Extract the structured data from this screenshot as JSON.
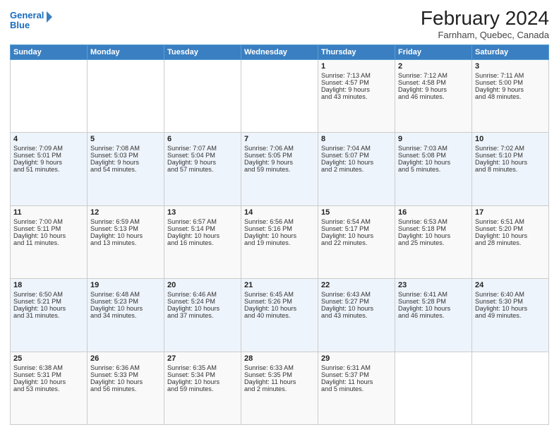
{
  "logo": {
    "line1": "General",
    "line2": "Blue",
    "icon": "▶"
  },
  "title": "February 2024",
  "subtitle": "Farnham, Quebec, Canada",
  "weekdays": [
    "Sunday",
    "Monday",
    "Tuesday",
    "Wednesday",
    "Thursday",
    "Friday",
    "Saturday"
  ],
  "weeks": [
    [
      {
        "day": "",
        "content": ""
      },
      {
        "day": "",
        "content": ""
      },
      {
        "day": "",
        "content": ""
      },
      {
        "day": "",
        "content": ""
      },
      {
        "day": "1",
        "content": "Sunrise: 7:13 AM\nSunset: 4:57 PM\nDaylight: 9 hours\nand 43 minutes."
      },
      {
        "day": "2",
        "content": "Sunrise: 7:12 AM\nSunset: 4:58 PM\nDaylight: 9 hours\nand 46 minutes."
      },
      {
        "day": "3",
        "content": "Sunrise: 7:11 AM\nSunset: 5:00 PM\nDaylight: 9 hours\nand 48 minutes."
      }
    ],
    [
      {
        "day": "4",
        "content": "Sunrise: 7:09 AM\nSunset: 5:01 PM\nDaylight: 9 hours\nand 51 minutes."
      },
      {
        "day": "5",
        "content": "Sunrise: 7:08 AM\nSunset: 5:03 PM\nDaylight: 9 hours\nand 54 minutes."
      },
      {
        "day": "6",
        "content": "Sunrise: 7:07 AM\nSunset: 5:04 PM\nDaylight: 9 hours\nand 57 minutes."
      },
      {
        "day": "7",
        "content": "Sunrise: 7:06 AM\nSunset: 5:05 PM\nDaylight: 9 hours\nand 59 minutes."
      },
      {
        "day": "8",
        "content": "Sunrise: 7:04 AM\nSunset: 5:07 PM\nDaylight: 10 hours\nand 2 minutes."
      },
      {
        "day": "9",
        "content": "Sunrise: 7:03 AM\nSunset: 5:08 PM\nDaylight: 10 hours\nand 5 minutes."
      },
      {
        "day": "10",
        "content": "Sunrise: 7:02 AM\nSunset: 5:10 PM\nDaylight: 10 hours\nand 8 minutes."
      }
    ],
    [
      {
        "day": "11",
        "content": "Sunrise: 7:00 AM\nSunset: 5:11 PM\nDaylight: 10 hours\nand 11 minutes."
      },
      {
        "day": "12",
        "content": "Sunrise: 6:59 AM\nSunset: 5:13 PM\nDaylight: 10 hours\nand 13 minutes."
      },
      {
        "day": "13",
        "content": "Sunrise: 6:57 AM\nSunset: 5:14 PM\nDaylight: 10 hours\nand 16 minutes."
      },
      {
        "day": "14",
        "content": "Sunrise: 6:56 AM\nSunset: 5:16 PM\nDaylight: 10 hours\nand 19 minutes."
      },
      {
        "day": "15",
        "content": "Sunrise: 6:54 AM\nSunset: 5:17 PM\nDaylight: 10 hours\nand 22 minutes."
      },
      {
        "day": "16",
        "content": "Sunrise: 6:53 AM\nSunset: 5:18 PM\nDaylight: 10 hours\nand 25 minutes."
      },
      {
        "day": "17",
        "content": "Sunrise: 6:51 AM\nSunset: 5:20 PM\nDaylight: 10 hours\nand 28 minutes."
      }
    ],
    [
      {
        "day": "18",
        "content": "Sunrise: 6:50 AM\nSunset: 5:21 PM\nDaylight: 10 hours\nand 31 minutes."
      },
      {
        "day": "19",
        "content": "Sunrise: 6:48 AM\nSunset: 5:23 PM\nDaylight: 10 hours\nand 34 minutes."
      },
      {
        "day": "20",
        "content": "Sunrise: 6:46 AM\nSunset: 5:24 PM\nDaylight: 10 hours\nand 37 minutes."
      },
      {
        "day": "21",
        "content": "Sunrise: 6:45 AM\nSunset: 5:26 PM\nDaylight: 10 hours\nand 40 minutes."
      },
      {
        "day": "22",
        "content": "Sunrise: 6:43 AM\nSunset: 5:27 PM\nDaylight: 10 hours\nand 43 minutes."
      },
      {
        "day": "23",
        "content": "Sunrise: 6:41 AM\nSunset: 5:28 PM\nDaylight: 10 hours\nand 46 minutes."
      },
      {
        "day": "24",
        "content": "Sunrise: 6:40 AM\nSunset: 5:30 PM\nDaylight: 10 hours\nand 49 minutes."
      }
    ],
    [
      {
        "day": "25",
        "content": "Sunrise: 6:38 AM\nSunset: 5:31 PM\nDaylight: 10 hours\nand 53 minutes."
      },
      {
        "day": "26",
        "content": "Sunrise: 6:36 AM\nSunset: 5:33 PM\nDaylight: 10 hours\nand 56 minutes."
      },
      {
        "day": "27",
        "content": "Sunrise: 6:35 AM\nSunset: 5:34 PM\nDaylight: 10 hours\nand 59 minutes."
      },
      {
        "day": "28",
        "content": "Sunrise: 6:33 AM\nSunset: 5:35 PM\nDaylight: 11 hours\nand 2 minutes."
      },
      {
        "day": "29",
        "content": "Sunrise: 6:31 AM\nSunset: 5:37 PM\nDaylight: 11 hours\nand 5 minutes."
      },
      {
        "day": "",
        "content": ""
      },
      {
        "day": "",
        "content": ""
      }
    ]
  ]
}
